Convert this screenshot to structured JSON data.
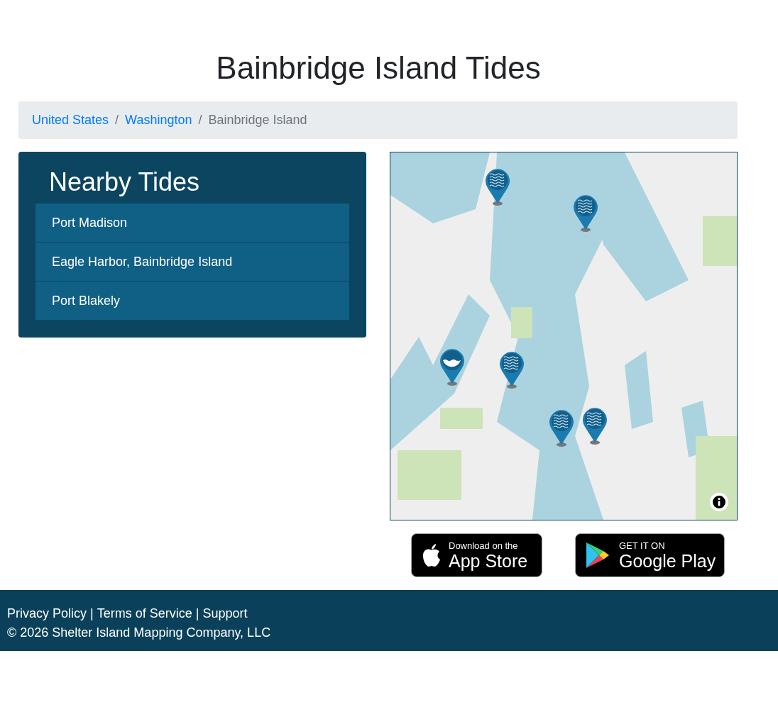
{
  "title": "Bainbridge Island Tides",
  "breadcrumb": [
    {
      "label": "United States",
      "kind": "link"
    },
    {
      "label": "Washington",
      "kind": "link"
    },
    {
      "label": "Bainbridge Island",
      "kind": "current"
    }
  ],
  "nearby": {
    "heading": "Nearby Tides",
    "items": [
      "Port Madison",
      "Eagle Harbor, Bainbridge Island",
      "Port Blakely"
    ]
  },
  "breadcrumb_separator": "/",
  "map": {
    "kind": "picture",
    "markers": [
      {
        "kind": "waves"
      },
      {
        "kind": "waves"
      },
      {
        "kind": "basin"
      },
      {
        "kind": "waves"
      },
      {
        "kind": "waves"
      },
      {
        "kind": "waves"
      }
    ]
  },
  "badges": [
    {
      "kind": "apple",
      "small": "Download on the",
      "big": "App Store"
    },
    {
      "kind": "google",
      "small": "GET IT ON",
      "big": "Google Play"
    }
  ],
  "footer": {
    "links": [
      "Privacy Policy",
      "Terms of Service",
      "Support"
    ],
    "separator": "|",
    "copyright": "© 2026 Shelter Island Mapping Company, LLC"
  }
}
